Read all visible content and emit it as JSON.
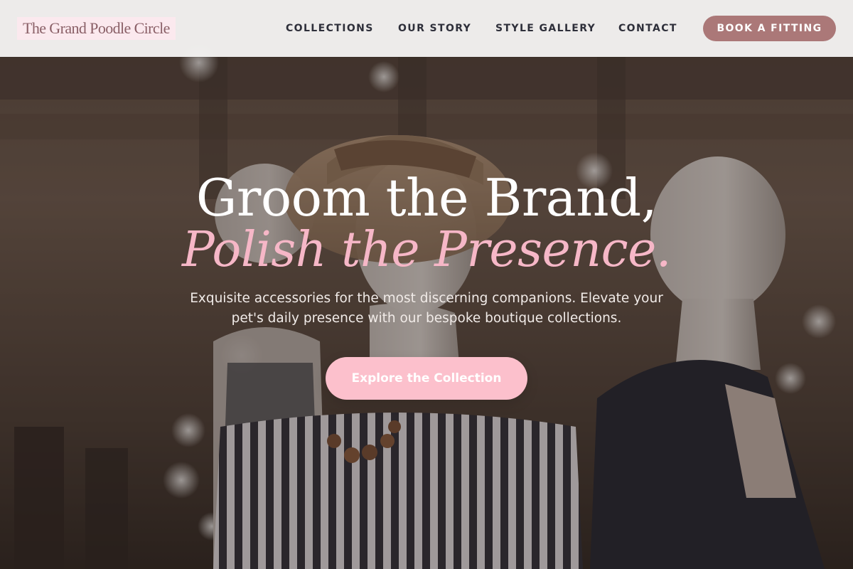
{
  "brand": {
    "logo_text": "The Grand Poodle Circle"
  },
  "nav": {
    "items": [
      {
        "label": "COLLECTIONS"
      },
      {
        "label": "OUR STORY"
      },
      {
        "label": "STYLE GALLERY"
      },
      {
        "label": "CONTACT"
      }
    ],
    "cta_label": "BOOK A FITTING"
  },
  "hero": {
    "headline": "Groom the Brand,",
    "headline_accent": "Polish the Presence.",
    "subtext": "Exquisite accessories for the most discerning companions. Elevate your pet's daily presence with our bespoke boutique collections.",
    "cta_label": "Explore the Collection",
    "background_image": "boutique-mannequins-photo"
  },
  "colors": {
    "accent_pink": "#f6b7c7",
    "cta_pink": "#fcc0cc",
    "nav_cta": "#ab7878",
    "logo_text": "#8a6067",
    "logo_bg": "#fbe9ee",
    "nav_text": "#2e2f3a"
  }
}
